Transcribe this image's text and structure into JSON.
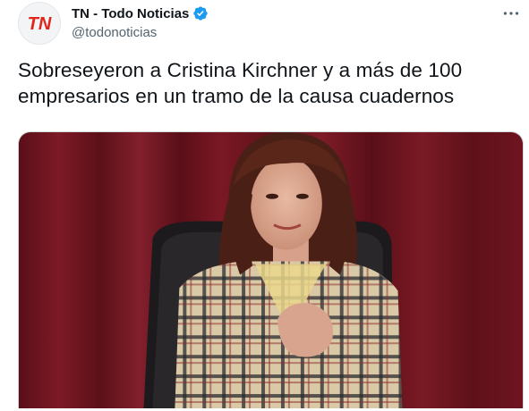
{
  "account": {
    "display_name": "TN - Todo Noticias",
    "handle": "@todonoticias",
    "avatar_logo": "TN",
    "verified_icon": "verified-badge-icon",
    "brand_color": "#e1251b",
    "verified_color": "#1d9bf0"
  },
  "menu": {
    "icon": "more-horizontal-icon"
  },
  "tweet": {
    "text": "Sobreseyeron a Cristina Kirchner y a más de 100 empresarios en un tramo de la causa cuadernos"
  },
  "media": {
    "icon": "photo-icon",
    "colors": {
      "curtain": "#6e1420",
      "chair": "#1c1a1c",
      "jacket": "#d9c9a6",
      "hair": "#4a2016"
    }
  }
}
